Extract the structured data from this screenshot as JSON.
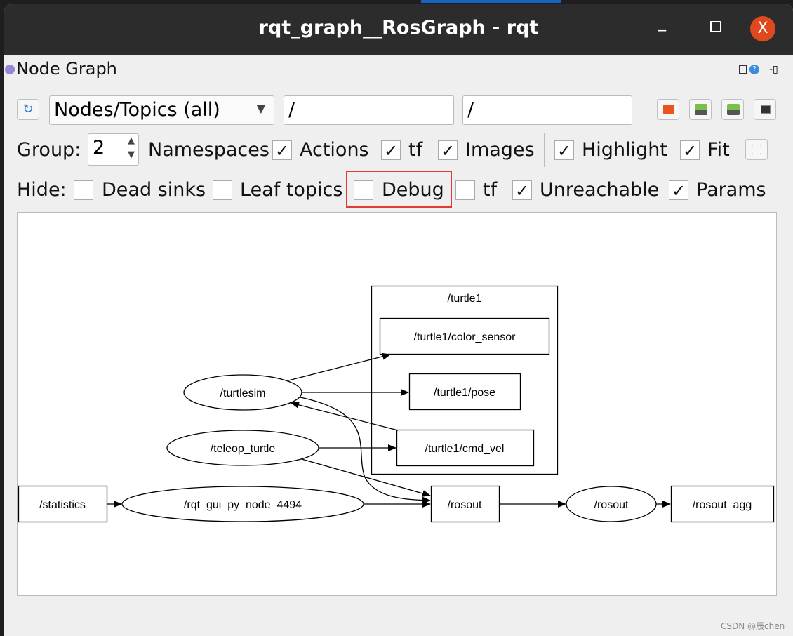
{
  "window": {
    "title": "rqt_graph__RosGraph - rqt",
    "minimize": "_",
    "close": "X"
  },
  "dock": {
    "title": "Node Graph"
  },
  "toolbar": {
    "view_mode": "Nodes/Topics (all)",
    "node_filter": "/",
    "topic_filter": "/",
    "buttons": [
      "refresh-icon",
      "load-dot-icon",
      "save-dot-icon",
      "save-image-icon",
      "screenshot-icon"
    ]
  },
  "options": {
    "group_label": "Group:",
    "group_value": "2",
    "checks": [
      {
        "label": "Namespaces",
        "checked": true
      },
      {
        "label": "Actions",
        "checked": true
      },
      {
        "label": "tf",
        "checked": true
      },
      {
        "label": "Images",
        "checked": true
      },
      {
        "label": "Highlight",
        "checked": true
      },
      {
        "label": "Fit",
        "checked": true
      }
    ]
  },
  "hide": {
    "label": "Hide:",
    "checks": [
      {
        "label": "Dead sinks",
        "checked": false
      },
      {
        "label": "Leaf topics",
        "checked": false
      },
      {
        "label": "Debug",
        "checked": false
      },
      {
        "label": "tf",
        "checked": false
      },
      {
        "label": "Unreachable",
        "checked": true
      },
      {
        "label": "Params",
        "checked": true
      }
    ]
  },
  "graph": {
    "cluster": "/turtle1",
    "topics": [
      "/turtle1/color_sensor",
      "/turtle1/pose",
      "/turtle1/cmd_vel",
      "/statistics",
      "/rosout",
      "/rosout_agg"
    ],
    "nodes": [
      "/turtlesim",
      "/teleop_turtle",
      "/rqt_gui_py_node_4494",
      "/rosout"
    ],
    "edges": [
      [
        "/turtlesim",
        "/turtle1/color_sensor"
      ],
      [
        "/turtlesim",
        "/turtle1/pose"
      ],
      [
        "/turtle1/cmd_vel",
        "/turtlesim"
      ],
      [
        "/turtlesim",
        "/rosout"
      ],
      [
        "/teleop_turtle",
        "/turtle1/cmd_vel"
      ],
      [
        "/teleop_turtle",
        "/rosout"
      ],
      [
        "/statistics",
        "/rqt_gui_py_node_4494"
      ],
      [
        "/rqt_gui_py_node_4494",
        "/rosout"
      ],
      [
        "/rosout",
        "/rosout"
      ],
      [
        "/rosout",
        "/rosout_agg"
      ]
    ]
  },
  "watermark": "CSDN @辰chen"
}
